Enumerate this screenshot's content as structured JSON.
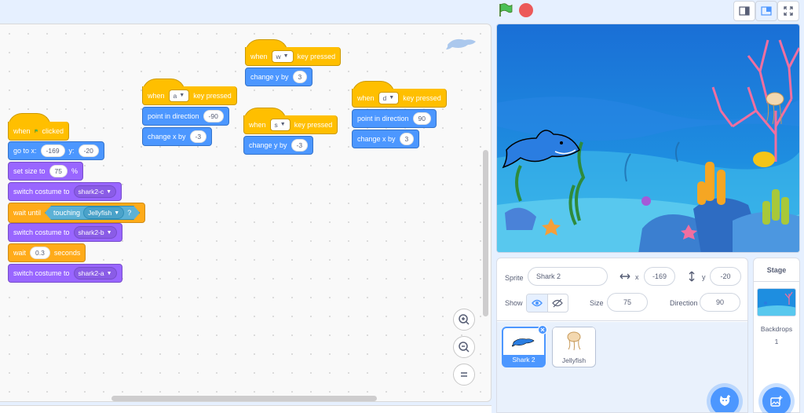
{
  "header": {
    "green_flag": "green-flag-icon",
    "stop": "stop-icon",
    "views": [
      "small-stage-icon",
      "normal-stage-icon",
      "fullscreen-icon"
    ]
  },
  "colors": {
    "events": "#ffbf00",
    "motion": "#4c97ff",
    "looks": "#9966ff",
    "control": "#ffab19",
    "sensing": "#5cb1d6",
    "accent": "#4c97ff"
  },
  "scripts": {
    "flag_script": {
      "hat_when": "when",
      "hat_clicked": "clicked",
      "goto_label": "go to x:",
      "goto_x": "-169",
      "goto_y_label": "y:",
      "goto_y": "-20",
      "size_label": "set size to",
      "size_value": "75",
      "size_unit": "%",
      "costume1_label": "switch costume to",
      "costume1_value": "shark2-c",
      "wait_until_label": "wait until",
      "touching_label": "touching",
      "touching_value": "Jellyfish",
      "touching_q": "?",
      "costume2_label": "switch costume to",
      "costume2_value": "shark2-b",
      "wait_label": "wait",
      "wait_value": "0.3",
      "wait_unit": "seconds",
      "costume3_label": "switch costume to",
      "costume3_value": "shark2-a"
    },
    "key_a": {
      "when": "when",
      "key": "a",
      "pressed": "key pressed",
      "b1_label": "point in direction",
      "b1_value": "-90",
      "b2_label": "change x by",
      "b2_value": "-3"
    },
    "key_w": {
      "when": "when",
      "key": "w",
      "pressed": "key pressed",
      "b1_label": "change y by",
      "b1_value": "3"
    },
    "key_s": {
      "when": "when",
      "key": "s",
      "pressed": "key pressed",
      "b1_label": "change y by",
      "b1_value": "-3"
    },
    "key_d": {
      "when": "when",
      "key": "d",
      "pressed": "key pressed",
      "b1_label": "point in direction",
      "b1_value": "90",
      "b2_label": "change x by",
      "b2_value": "3"
    }
  },
  "sprite_info": {
    "sprite_label": "Sprite",
    "sprite_name": "Shark 2",
    "x_label": "x",
    "x_value": "-169",
    "y_label": "y",
    "y_value": "-20",
    "show_label": "Show",
    "size_label": "Size",
    "size_value": "75",
    "direction_label": "Direction",
    "direction_value": "90"
  },
  "sprites": [
    {
      "name": "Shark 2",
      "selected": true
    },
    {
      "name": "Jellyfish",
      "selected": false
    }
  ],
  "stage_pane": {
    "title": "Stage",
    "backdrops_label": "Backdrops",
    "backdrops_count": "1"
  }
}
